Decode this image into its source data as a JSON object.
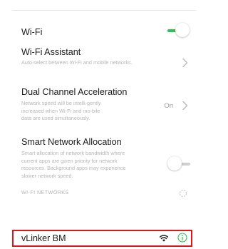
{
  "settings": {
    "wifi": {
      "title": "Wi-Fi",
      "enabled": true
    },
    "wifi_assistant": {
      "title": "Wi-Fi Assistant",
      "description": "Auto select between Wi-Fi and mobile networks."
    },
    "dual_channel": {
      "title": "Dual Channel Acceleration",
      "description": "Network speed will be intelli-gently increased when Wi-Fi and mo-bile data are used simultaneously.",
      "value": "On"
    },
    "smart_allocation": {
      "title": "Smart Network Allocation",
      "description": "Smart allocation of network bandwidth where current apps are given priority for network resources. Background apps may experience slower network speed.",
      "enabled": false
    }
  },
  "networks": {
    "section_label": "WI-FI NETWORKS",
    "scanning": true,
    "items": [
      {
        "name": "vLinker BM",
        "highlighted": true
      }
    ]
  },
  "colors": {
    "toggle_on": "#2ec24f",
    "highlight_border": "#e0151b",
    "info_icon": "#2ec24f"
  },
  "icons": {
    "wifi_signal": "wifi-signal-icon",
    "info": "info-icon",
    "chevron": "chevron-right-icon",
    "spinner": "loading-spinner-icon"
  }
}
